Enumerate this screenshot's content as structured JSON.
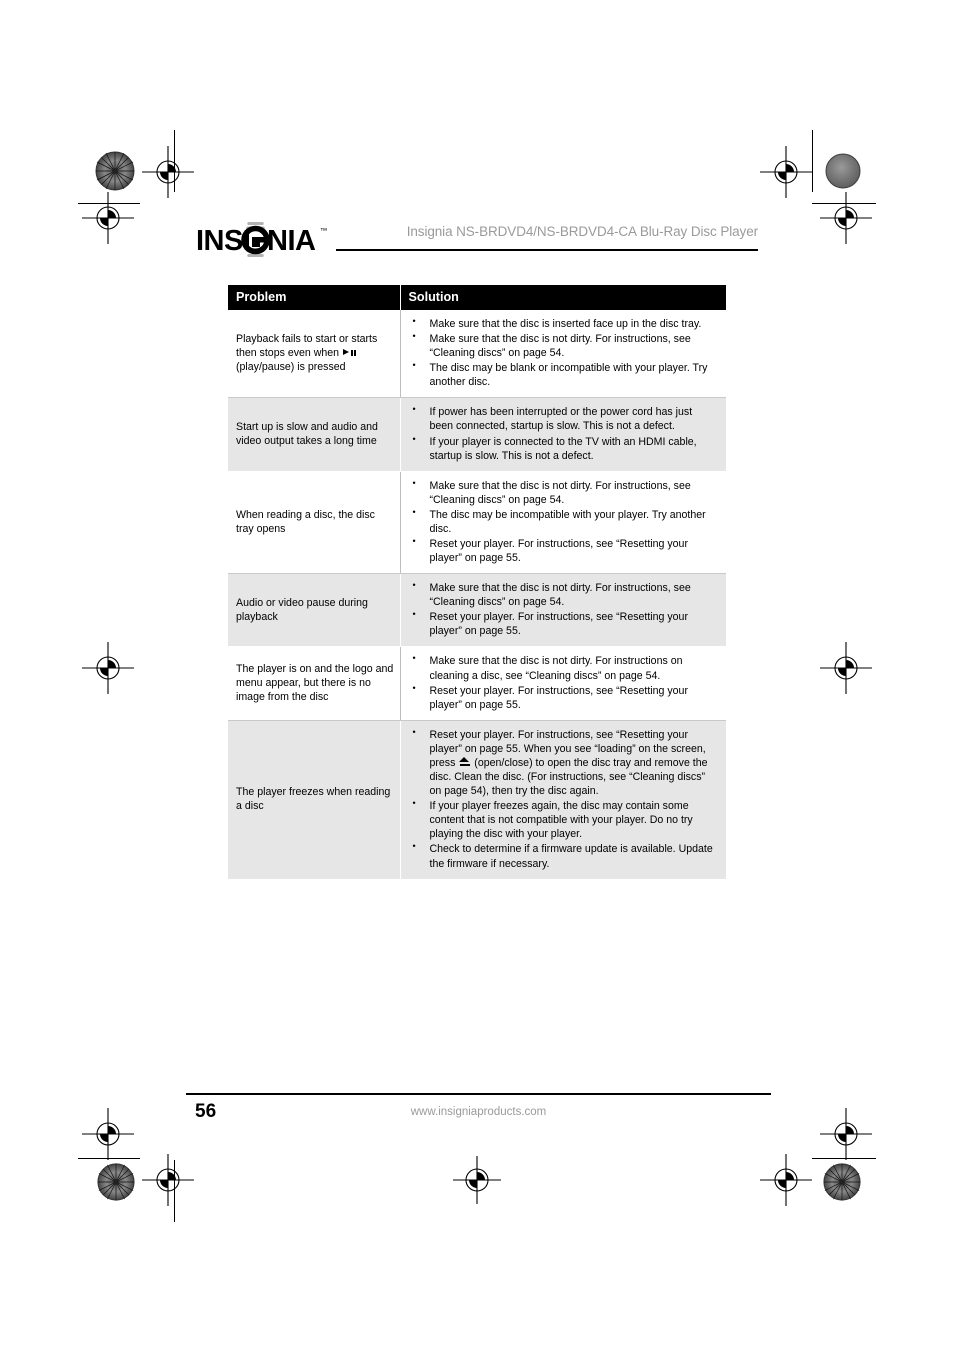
{
  "document": {
    "brand": "INSIGNIA",
    "brand_trademark": "™",
    "header_title": "Insignia NS-BRDVD4/NS-BRDVD4-CA Blu-Ray Disc Player",
    "page_number": "56",
    "footer_url": "www.insigniaproducts.com"
  },
  "table": {
    "columns": [
      "Problem",
      "Solution"
    ],
    "rows": [
      {
        "shaded": false,
        "problem_pre": "Playback fails to start or starts then stops even when ",
        "problem_icon": "play-pause-icon",
        "problem_post": " (play/pause) is pressed",
        "solutions": [
          "Make sure that the disc is inserted face up in the disc tray.",
          "Make sure that the disc is not dirty. For instructions, see “Cleaning discs” on page 54.",
          "The disc may be blank or incompatible with your player. Try another disc."
        ]
      },
      {
        "shaded": true,
        "problem": "Start up is slow and audio and video output takes a long time",
        "solutions": [
          "If power has been interrupted or the power cord has just been connected, startup is slow. This is not a defect.",
          "If your player is connected to the TV with an HDMI cable, startup is slow. This is not a defect."
        ]
      },
      {
        "shaded": false,
        "problem": "When reading a disc, the disc tray opens",
        "solutions": [
          "Make sure that the disc is not dirty. For instructions, see “Cleaning discs” on page 54.",
          "The disc may be incompatible with your player. Try another disc.",
          "Reset your player. For instructions, see “Resetting your player” on page 55."
        ]
      },
      {
        "shaded": true,
        "problem": "Audio or video pause during playback",
        "solutions": [
          "Make sure that the disc is not dirty. For instructions, see “Cleaning discs” on page 54.",
          "Reset your player. For instructions, see “Resetting your player” on page 55."
        ]
      },
      {
        "shaded": false,
        "problem": "The player is on and the logo and menu appear, but there is no image from the disc",
        "solutions": [
          "Make sure that the disc is not dirty. For instructions on cleaning a disc, see “Cleaning discs” on page 54.",
          "Reset your player. For instructions, see “Resetting your player” on page 55."
        ]
      },
      {
        "shaded": true,
        "problem": "The player freezes when reading a disc",
        "solutions_rich": [
          {
            "pre": "Reset your player. For instructions, see “Resetting your player” on page 55. When you see “loading” on the screen, press ",
            "icon": "eject-icon",
            "post": " (open/close) to open the disc tray and remove the disc. Clean the disc. (For instructions, see “Cleaning discs” on page 54), then try the disc again."
          },
          {
            "pre": "If your player freezes again, the disc may contain some content that is not compatible with your player. Do no try playing the disc with your player."
          },
          {
            "pre": "Check to determine if a firmware update is available. Update the firmware if necessary."
          }
        ]
      }
    ]
  }
}
